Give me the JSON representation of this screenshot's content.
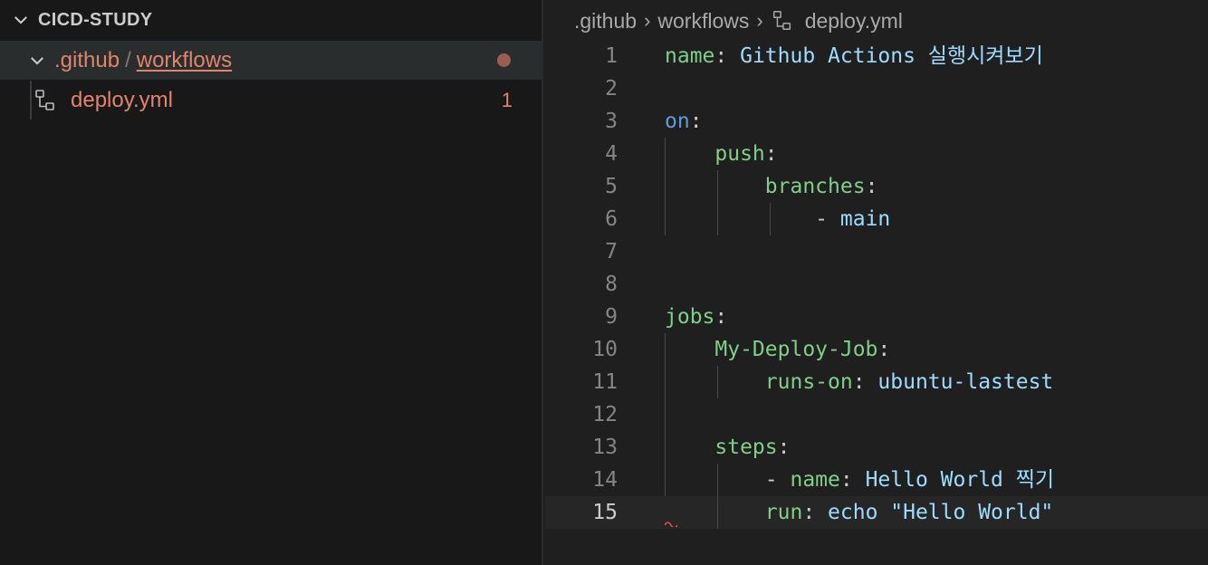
{
  "explorer": {
    "root_label": "CICD-STUDY",
    "folder": {
      "part1": ".github",
      "separator": "/",
      "part2": "workflows"
    },
    "file": {
      "name": "deploy.yml",
      "problem_count": "1"
    }
  },
  "breadcrumb": {
    "part1": ".github",
    "part2": "workflows",
    "file": "deploy.yml"
  },
  "editor": {
    "current_line": 15,
    "lines": [
      {
        "n": "1",
        "tokens": [
          {
            "t": "name",
            "c": "key"
          },
          {
            "t": ": ",
            "c": "punct"
          },
          {
            "t": "Github Actions 실행시켜보기",
            "c": "str"
          }
        ],
        "guides": []
      },
      {
        "n": "2",
        "tokens": [],
        "guides": []
      },
      {
        "n": "3",
        "tokens": [
          {
            "t": "on",
            "c": "kblue"
          },
          {
            "t": ":",
            "c": "punct"
          }
        ],
        "guides": []
      },
      {
        "n": "4",
        "tokens": [
          {
            "t": "    push",
            "c": "key"
          },
          {
            "t": ":",
            "c": "punct"
          }
        ],
        "guides": [
          0
        ]
      },
      {
        "n": "5",
        "tokens": [
          {
            "t": "        branches",
            "c": "key"
          },
          {
            "t": ":",
            "c": "punct"
          }
        ],
        "guides": [
          0,
          1
        ]
      },
      {
        "n": "6",
        "tokens": [
          {
            "t": "            - ",
            "c": "punct"
          },
          {
            "t": "main",
            "c": "str"
          }
        ],
        "guides": [
          0,
          1,
          2
        ]
      },
      {
        "n": "7",
        "tokens": [],
        "guides": []
      },
      {
        "n": "8",
        "tokens": [],
        "guides": []
      },
      {
        "n": "9",
        "tokens": [
          {
            "t": "jobs",
            "c": "key"
          },
          {
            "t": ":",
            "c": "punct"
          }
        ],
        "guides": []
      },
      {
        "n": "10",
        "tokens": [
          {
            "t": "    My-Deploy-Job",
            "c": "key"
          },
          {
            "t": ":",
            "c": "punct"
          }
        ],
        "guides": [
          0
        ]
      },
      {
        "n": "11",
        "tokens": [
          {
            "t": "        runs-on",
            "c": "key"
          },
          {
            "t": ": ",
            "c": "punct"
          },
          {
            "t": "ubuntu-lastest",
            "c": "str"
          }
        ],
        "guides": [
          0,
          1
        ]
      },
      {
        "n": "12",
        "tokens": [],
        "guides": [
          0
        ]
      },
      {
        "n": "13",
        "tokens": [
          {
            "t": "    steps",
            "c": "key"
          },
          {
            "t": ":",
            "c": "punct"
          }
        ],
        "guides": [
          0
        ]
      },
      {
        "n": "14",
        "tokens": [
          {
            "t": "        - ",
            "c": "punct"
          },
          {
            "t": "name",
            "c": "key"
          },
          {
            "t": ": ",
            "c": "punct"
          },
          {
            "t": "Hello World 찍기",
            "c": "str"
          }
        ],
        "guides": [
          0,
          1
        ]
      },
      {
        "n": "15",
        "tokens": [
          {
            "t": "        run",
            "c": "key"
          },
          {
            "t": ": ",
            "c": "punct"
          },
          {
            "t": "echo \"Hello World\"",
            "c": "str"
          }
        ],
        "guides": [
          1
        ]
      }
    ]
  },
  "colors": {
    "accent_file": "#e2836c",
    "key": "#7fcf8a",
    "value": "#9cdcfe",
    "keyword": "#5f9bd6"
  }
}
